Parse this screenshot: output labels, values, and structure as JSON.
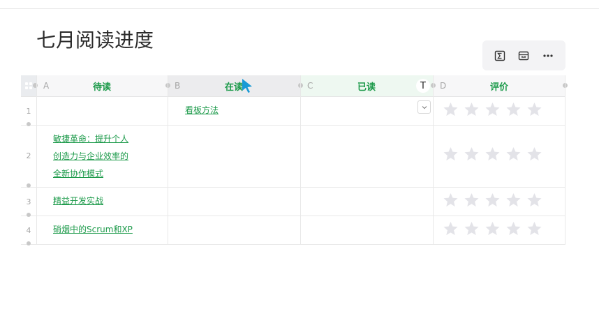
{
  "page": {
    "title": "七月阅读进度"
  },
  "toolbar": {
    "icons": [
      "sum-icon",
      "column-width-icon",
      "more-icon"
    ]
  },
  "table": {
    "columns": [
      {
        "letter": "A",
        "title": "待读"
      },
      {
        "letter": "B",
        "title": "在读"
      },
      {
        "letter": "C",
        "title": "已读",
        "type_icon": "T"
      },
      {
        "letter": "D",
        "title": "评价"
      }
    ],
    "rows": [
      {
        "num": "1",
        "a": [],
        "b": [
          "看板方法"
        ],
        "c": [],
        "rating": 0
      },
      {
        "num": "2",
        "a": [
          "敏捷革命：提升个人",
          "创造力与企业效率的",
          "全新协作模式"
        ],
        "b": [],
        "c": [],
        "rating": 0
      },
      {
        "num": "3",
        "a": [
          "精益开发实战"
        ],
        "b": [],
        "c": [],
        "rating": 0
      },
      {
        "num": "4",
        "a": [
          "硝烟中的Scrum和XP"
        ],
        "b": [],
        "c": [],
        "rating": 0
      }
    ]
  },
  "colors": {
    "accent": "#1c9a4a",
    "star_empty": "#e3e3e8",
    "cursor": "#1a9ad6"
  }
}
